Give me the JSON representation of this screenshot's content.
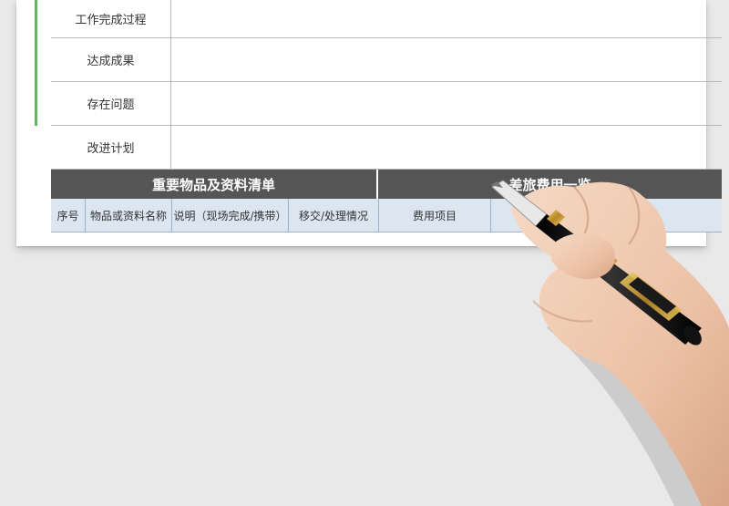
{
  "rows": [
    {
      "label": "工作完成过程"
    },
    {
      "label": "达成成果"
    },
    {
      "label": "存在问题"
    },
    {
      "label": "改进计划"
    }
  ],
  "section_headers": {
    "left": "重要物品及资料清单",
    "right": "差旅费用一览"
  },
  "columns": {
    "seq": "序号",
    "item_name": "物品或资料名称",
    "desc": "说明（现场完成/携带）",
    "handover": "移交/处理情况",
    "expense_item": "费用项目"
  },
  "colors": {
    "header_bg": "#555555",
    "subheader_bg": "#dce6f1",
    "accent": "#5fb85a"
  }
}
